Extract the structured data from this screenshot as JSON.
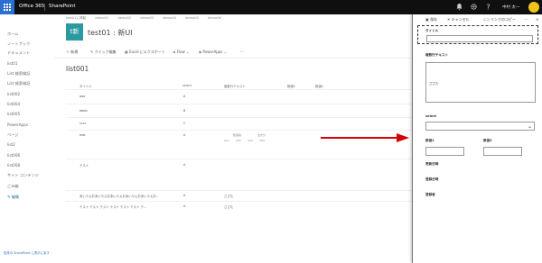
{
  "suite_bar": {
    "brand": "Office 365",
    "app": "SharePoint",
    "user_name": "中村 太一"
  },
  "left_nav": {
    "items": [
      "ホーム",
      "ノートブック",
      "ドキュメント",
      "list01",
      "List 検索検証",
      "List 検索検証",
      "list002",
      "list004",
      "list005",
      "PowerApps",
      "ページ",
      "list2",
      "list006",
      "list008",
      "サイト コンテンツ",
      "ごみ箱"
    ],
    "edit_label": "編集",
    "footer": "従来の SharePoint に表示に戻す"
  },
  "header": {
    "breadcrumbs": [
      "test01に移動",
      "demo01",
      "demo02",
      "demo03",
      "demo04",
      "demo05",
      "demo06"
    ],
    "site_logo": "t新",
    "site_title": "test01 : 新UI"
  },
  "command_bar": {
    "new": "＋ 新規",
    "quick_edit": "クイック編集",
    "excel_export": "Excel にエクスポート",
    "flow": "Flow ⌄",
    "powerapps": "PowerApps ⌄",
    "more": "···"
  },
  "list": {
    "title": "list001",
    "columns": [
      "タイトル",
      "select",
      "複数行テキスト",
      "数値1",
      "数値2"
    ],
    "rows": [
      {
        "title": "aaa",
        "select": "A",
        "text": ""
      },
      {
        "title": "bbbb",
        "select": "B",
        "text": ""
      },
      {
        "title": "cccc",
        "select": "C",
        "text": ""
      },
      {
        "title": "test",
        "select": "A",
        "text": ""
      },
      {
        "title": "テスト",
        "select": "A",
        "text": ""
      },
      {
        "title": "あいうえおあいうえおあいうえおあいうえおあいうえお...",
        "select": "A",
        "text": "ささた"
      },
      {
        "title": "テスト テスト テスト テスト テスト テスト テ...",
        "select": "A",
        "text": "ささた"
      }
    ],
    "subtable": {
      "headers": [
        "数値番",
        "全式分"
      ],
      "values": [
        "111",
        "222",
        "333",
        "444"
      ]
    }
  },
  "panel": {
    "toolbar": {
      "save": "保存",
      "cancel": "キャンセル",
      "copy_link": "リンクのコピー",
      "more": "···"
    },
    "fields": {
      "title_label": "タイトル",
      "multiline_label": "複数行テキスト",
      "multiline_value": "ささた",
      "select_label": "select",
      "num1_label": "数値1",
      "num2_label": "数値2",
      "modified_label": "更新日時",
      "created_label": "登録日時",
      "created_by_label": "登録者"
    }
  },
  "colors": {
    "suite_bar": "#0f0f0f",
    "waffle": "#2b6fd1",
    "site_logo": "#2b9aa0",
    "arrow": "#d40000",
    "avatar": "#f0c419"
  }
}
